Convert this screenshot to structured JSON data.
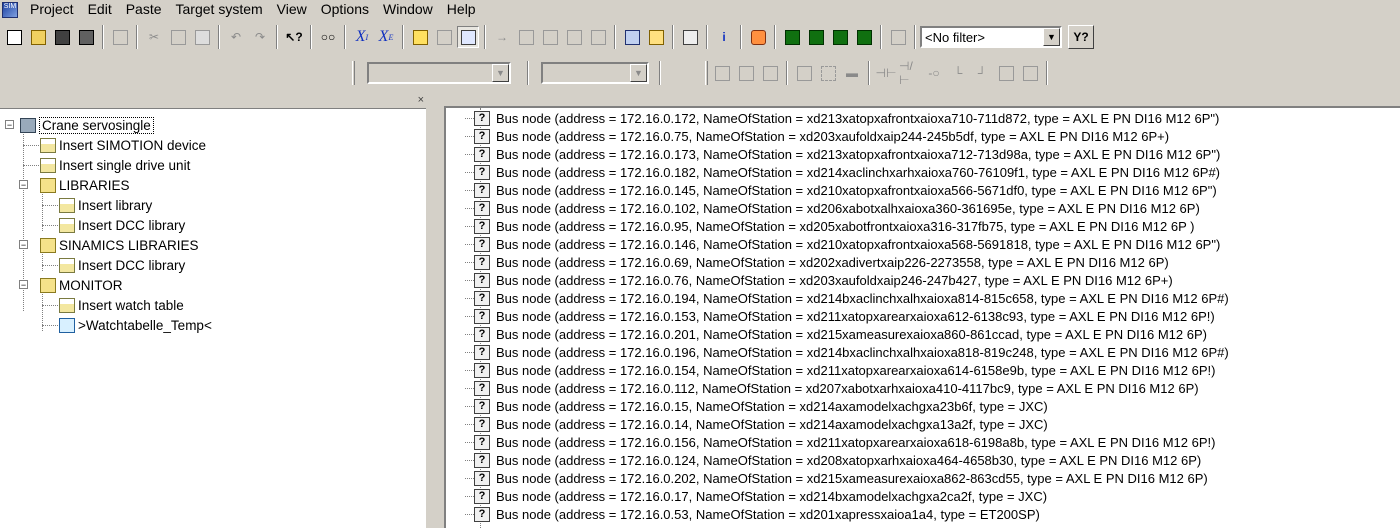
{
  "menu": {
    "app_icon_text": "SIM",
    "items": [
      "Project",
      "Edit",
      "Paste",
      "Target system",
      "View",
      "Options",
      "Window",
      "Help"
    ]
  },
  "toolbar": {
    "filter_value": "<No filter>"
  },
  "tree": {
    "root": "Crane servosingle",
    "insert_simotion": "Insert SIMOTION device",
    "insert_single_drive": "Insert single drive unit",
    "libraries": "LIBRARIES",
    "insert_library": "Insert library",
    "insert_dcc_library_1": "Insert DCC library",
    "sinamics_libraries": "SINAMICS LIBRARIES",
    "insert_dcc_library_2": "Insert DCC library",
    "monitor": "MONITOR",
    "insert_watch_table": "Insert watch table",
    "watch_temp": ">Watchtabelle_Temp<"
  },
  "bus_nodes": [
    "Bus node  (address = 172.16.0.172, NameOfStation = xd213xatopxafrontxaioxa710-711d872, type = AXL E PN DI16 M12 6P\")",
    "Bus node  (address = 172.16.0.75, NameOfStation = xd203xaufoldxaip244-245b5df, type = AXL E PN DI16 M12 6P+)",
    "Bus node  (address = 172.16.0.173, NameOfStation = xd213xatopxafrontxaioxa712-713d98a, type = AXL E PN DI16 M12 6P\")",
    "Bus node  (address = 172.16.0.182, NameOfStation = xd214xaclinchxarhxaioxa760-76109f1, type = AXL E PN DI16 M12 6P#)",
    "Bus node  (address = 172.16.0.145, NameOfStation = xd210xatopxafrontxaioxa566-5671df0, type = AXL E PN DI16 M12 6P\")",
    "Bus node  (address = 172.16.0.102, NameOfStation = xd206xabotxalhxaioxa360-361695e, type = AXL E PN DI16 M12 6P)",
    "Bus node  (address = 172.16.0.95, NameOfStation = xd205xabotfrontxaioxa316-317fb75, type = AXL E PN DI16 M12 6P )",
    "Bus node  (address = 172.16.0.146, NameOfStation = xd210xatopxafrontxaioxa568-5691818, type = AXL E PN DI16 M12 6P\")",
    "Bus node  (address = 172.16.0.69, NameOfStation = xd202xadivertxaip226-2273558, type = AXL E PN DI16 M12 6P)",
    "Bus node  (address = 172.16.0.76, NameOfStation = xd203xaufoldxaip246-247b427, type = AXL E PN DI16 M12 6P+)",
    "Bus node  (address = 172.16.0.194, NameOfStation = xd214bxaclinchxalhxaioxa814-815c658, type = AXL E PN DI16 M12 6P#)",
    "Bus node  (address = 172.16.0.153, NameOfStation = xd211xatopxarearxaioxa612-6138c93, type = AXL E PN DI16 M12 6P!)",
    "Bus node  (address = 172.16.0.201, NameOfStation = xd215xameasurexaioxa860-861ccad, type = AXL E PN DI16 M12 6P)",
    "Bus node  (address = 172.16.0.196, NameOfStation = xd214bxaclinchxalhxaioxa818-819c248, type = AXL E PN DI16 M12 6P#)",
    "Bus node  (address = 172.16.0.154, NameOfStation = xd211xatopxarearxaioxa614-6158e9b, type = AXL E PN DI16 M12 6P!)",
    "Bus node  (address = 172.16.0.112, NameOfStation = xd207xabotxarhxaioxa410-4117bc9, type = AXL E PN DI16 M12 6P)",
    "Bus node  (address = 172.16.0.15, NameOfStation = xd214axamodelxachgxa23b6f, type = JXC)",
    "Bus node  (address = 172.16.0.14, NameOfStation = xd214axamodelxachgxa13a2f, type = JXC)",
    "Bus node  (address = 172.16.0.156, NameOfStation = xd211xatopxarearxaioxa618-6198a8b, type = AXL E PN DI16 M12 6P!)",
    "Bus node  (address = 172.16.0.124, NameOfStation = xd208xatopxarhxaioxa464-4658b30, type = AXL E PN DI16 M12 6P)",
    "Bus node  (address = 172.16.0.202, NameOfStation = xd215xameasurexaioxa862-863cd55, type = AXL E PN DI16 M12 6P)",
    "Bus node  (address = 172.16.0.17, NameOfStation = xd214bxamodelxachgxa2ca2f, type = JXC)",
    "Bus node  (address = 172.16.0.53, NameOfStation = xd201xapressxaioa1a4, type = ET200SP)"
  ]
}
